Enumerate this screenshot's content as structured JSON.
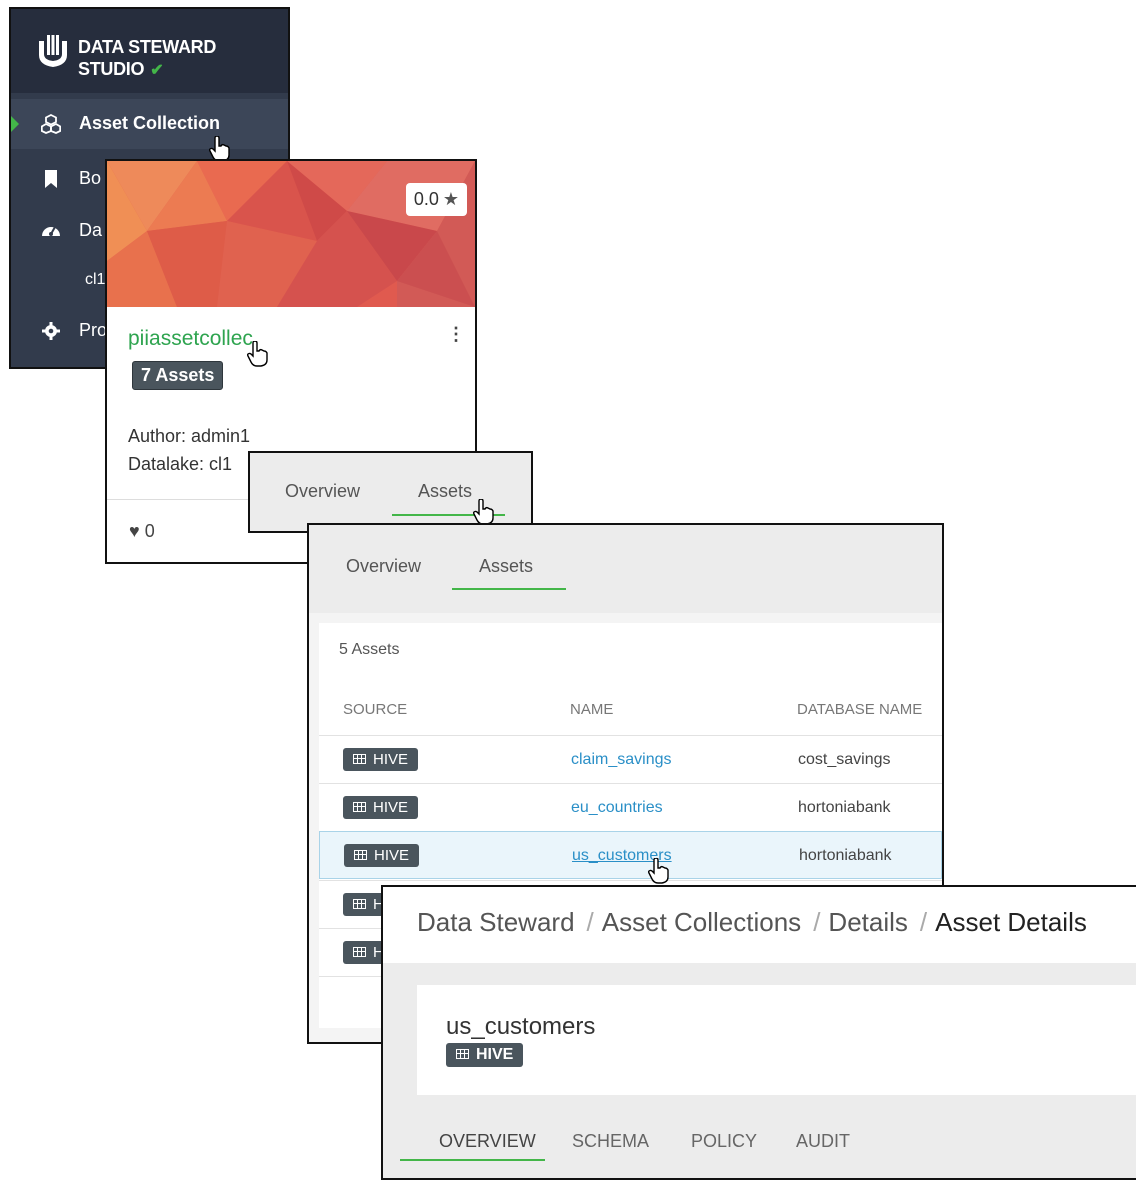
{
  "sidebar": {
    "brand_line1": "DATA STEWARD",
    "brand_line2": "STUDIO",
    "items": [
      {
        "label": "Asset Collection",
        "icon": "cubes-icon"
      },
      {
        "label": "Bo",
        "icon": "bookmark-icon"
      },
      {
        "label": "Da",
        "icon": "dashboard-icon"
      },
      {
        "label": "cl1",
        "icon": ""
      },
      {
        "label": "Pro",
        "icon": "gear-icon"
      }
    ]
  },
  "card": {
    "rating": "0.0",
    "title": "piiassetcollec",
    "assets_badge": "7 Assets",
    "author": "Author: admin1",
    "datalake": "Datalake: cl1",
    "likes": "0"
  },
  "tabs_small": {
    "overview": "Overview",
    "assets": "Assets"
  },
  "assets_panel": {
    "tabs": {
      "overview": "Overview",
      "assets": "Assets"
    },
    "count": "5 Assets",
    "columns": {
      "source": "SOURCE",
      "name": "NAME",
      "database": "DATABASE NAME"
    },
    "rows": [
      {
        "source": "HIVE",
        "name": "claim_savings",
        "database": "cost_savings"
      },
      {
        "source": "HIVE",
        "name": "eu_countries",
        "database": "hortoniabank"
      },
      {
        "source": "HIVE",
        "name": "us_customers",
        "database": "hortoniabank"
      },
      {
        "source": "HIVE",
        "name": "",
        "database": ""
      },
      {
        "source": "HIVE",
        "name": "",
        "database": ""
      }
    ]
  },
  "details": {
    "breadcrumb": [
      "Data Steward",
      "Asset Collections",
      "Details",
      "Asset Details"
    ],
    "asset_name": "us_customers",
    "source": "HIVE",
    "tabs": [
      "OVERVIEW",
      "SCHEMA",
      "POLICY",
      "AUDIT"
    ]
  },
  "colors": {
    "accent": "#43b649",
    "sidebar": "#323b4c",
    "link": "#2a8fc7",
    "badge": "#4a555d"
  }
}
